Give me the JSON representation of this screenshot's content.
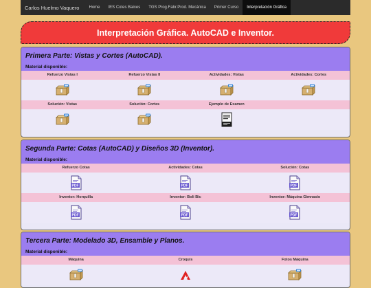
{
  "nav": {
    "brand": "Carlos Huelmo Vaquero",
    "items": [
      "Home",
      "IES Cotes Baixes",
      "TGS Prog.Fabr.Prod. Mecánica",
      "Primer Curso",
      "Interpretación Gráfica"
    ],
    "active": 4
  },
  "banner": {
    "title": "Interpretación Gráfica. AutoCAD e Inventor."
  },
  "sections": [
    {
      "title": "Primera Parte: Vistas y Cortes (AutoCAD).",
      "subtitle": "Material disponible:",
      "rows": [
        {
          "labels": [
            "Refuerzo Vistas I",
            "Refuerzo Vistas II",
            "Actividades: Vistas",
            "Actividades: Cortes"
          ],
          "icons": [
            "zip-archive-icon",
            "zip-archive-icon",
            "zip-archive-icon",
            "zip-archive-icon"
          ]
        },
        {
          "labels": [
            "Solución: Vistas",
            "Solución: Cortes",
            "Ejemplo de Examen",
            ""
          ],
          "icons": [
            "zip-archive-icon",
            "zip-archive-icon",
            "document-icon",
            ""
          ]
        }
      ]
    },
    {
      "title": "Segunda Parte: Cotas (AutoCAD) y Diseños 3D (Inventor).",
      "subtitle": "Material disponible:",
      "rows": [
        {
          "labels": [
            "Refuerzo Cotas",
            "Actividades: Cotas",
            "Solución: Cotas"
          ],
          "icons": [
            "pdf-file-icon",
            "pdf-file-icon",
            "pdf-file-icon"
          ]
        },
        {
          "labels": [
            "Inventor: Horquilla",
            "Inventor: Boli Bic",
            "Inventor: Máquina Gimnasio"
          ],
          "icons": [
            "pdf-file-icon",
            "pdf-file-icon",
            "pdf-file-icon"
          ]
        }
      ]
    },
    {
      "title": "Tercera Parte: Modelado 3D, Ensamble y Planos.",
      "subtitle": "Material disponible:",
      "rows": [
        {
          "labels": [
            "Máquina",
            "Croquis",
            "Fotos Máquina"
          ],
          "icons": [
            "zip-archive-icon",
            "autodesk-icon",
            "zip-archive-icon"
          ]
        }
      ]
    }
  ],
  "colors": {
    "page_bg": "#e9c77f",
    "navbar_bg": "#2b2b2b",
    "banner_bg": "#f03a3a",
    "section_header": "#9b7df0",
    "label_row": "#f4c2d6",
    "icon_row": "#ece9f8"
  }
}
